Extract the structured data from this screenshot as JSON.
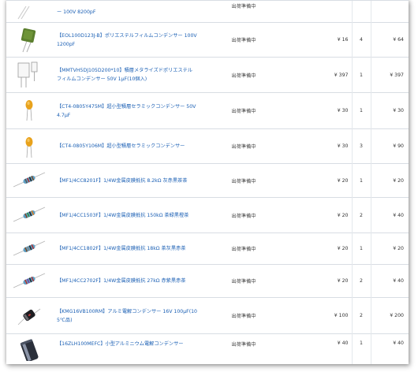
{
  "rows": [
    {
      "name": "ー 100V 8200pF",
      "icon": "capacitor-film-small-icon",
      "status": "出荷準備中",
      "price": "",
      "qty": "",
      "subtotal": ""
    },
    {
      "name": "【EOL100D123J-B】ポリエステルフィルムコンデンサー 100V 1200pF",
      "icon": "capacitor-film-green-icon",
      "status": "出荷準備中",
      "price": "¥ 16",
      "qty": "4",
      "subtotal": "¥ 64"
    },
    {
      "name": "【MMTVH5DJ105D200*10】積層メタライズドポリエステルフィルムコンデンサー 50V 1μF(10個入)",
      "icon": "capacitor-film-white-icon",
      "status": "出荷準備中",
      "price": "¥ 397",
      "qty": "1",
      "subtotal": "¥ 397"
    },
    {
      "name": "【CT4-0805Y475M】超小型積層セラミックコンデンサー 50V 4.7μF",
      "icon": "capacitor-ceramic-icon",
      "status": "出荷準備中",
      "price": "¥ 30",
      "qty": "1",
      "subtotal": "¥ 30"
    },
    {
      "name": "【CT4-0805Y106M】超小型積層セラミックコンデンサー",
      "icon": "capacitor-ceramic-icon",
      "status": "出荷準備中",
      "price": "¥ 30",
      "qty": "3",
      "subtotal": "¥ 90"
    },
    {
      "name": "【MF1/4CC8201F】1/4W金属皮膜抵抗 8.2kΩ 灰赤黒茶茶",
      "icon": "resistor-icon",
      "status": "出荷準備中",
      "price": "¥ 20",
      "qty": "1",
      "subtotal": "¥ 20"
    },
    {
      "name": "【MF1/4CC1503F】1/4W金属皮膜抵抗 150kΩ 茶緑黒橙茶",
      "icon": "resistor-icon",
      "status": "出荷準備中",
      "price": "¥ 20",
      "qty": "2",
      "subtotal": "¥ 40"
    },
    {
      "name": "【MF1/4CC1802F】1/4W金属皮膜抵抗 18kΩ 茶灰黒赤茶",
      "icon": "resistor-icon",
      "status": "出荷準備中",
      "price": "¥ 20",
      "qty": "1",
      "subtotal": "¥ 20"
    },
    {
      "name": "【MF1/4CC2702F】1/4W金属皮膜抵抗 27kΩ 赤紫黒赤茶",
      "icon": "resistor-icon",
      "status": "出荷準備中",
      "price": "¥ 20",
      "qty": "2",
      "subtotal": "¥ 40"
    },
    {
      "name": "【KMG16VB100RM】アルミ電解コンデンサー 16V 100μF(105℃品)",
      "icon": "capacitor-electrolytic-icon",
      "status": "出荷準備中",
      "price": "¥ 100",
      "qty": "2",
      "subtotal": "¥ 200"
    },
    {
      "name": "【16ZLH100MEFC】小型アルミニウム電解コンデンサー",
      "icon": "capacitor-electrolytic-large-icon",
      "status": "出荷準備中",
      "price": "¥ 40",
      "qty": "1",
      "subtotal": "¥ 40"
    }
  ]
}
